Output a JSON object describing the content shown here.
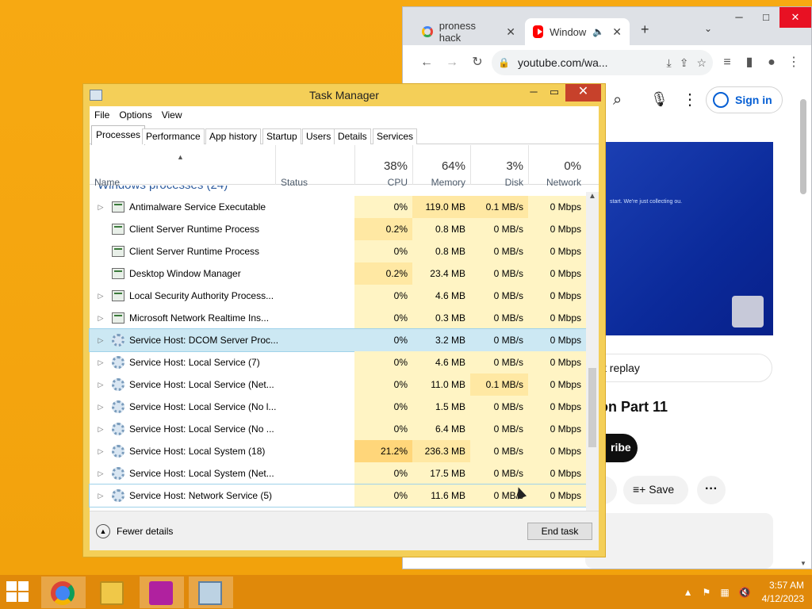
{
  "chrome": {
    "tabs": [
      {
        "title": "proness hack",
        "close": "✕"
      },
      {
        "title": "Window",
        "close": "✕"
      }
    ],
    "new_tab": "+",
    "url": "youtube.com/wa...",
    "youtube": {
      "sign_in": "Sign in",
      "replay": "t replay",
      "title_fragment": "on Part 11",
      "subscribe_fragment": "ribe",
      "save": "Save",
      "video_text": "start. We're just collecting ou."
    }
  },
  "taskmanager": {
    "title": "Task Manager",
    "menu": [
      "File",
      "Options",
      "View"
    ],
    "tabs": [
      "Processes",
      "Performance",
      "App history",
      "Startup",
      "Users",
      "Details",
      "Services"
    ],
    "columns": {
      "name": "Name",
      "status": "Status",
      "cpu": {
        "pct": "38%",
        "label": "CPU"
      },
      "memory": {
        "pct": "64%",
        "label": "Memory"
      },
      "disk": {
        "pct": "3%",
        "label": "Disk"
      },
      "network": {
        "pct": "0%",
        "label": "Network"
      }
    },
    "group_header": "Windows processes (24)",
    "rows": [
      {
        "name": "Antimalware Service Executable",
        "cpu": "0%",
        "memory": "119.0 MB",
        "disk": "0.1 MB/s",
        "network": "0 Mbps"
      },
      {
        "name": "Client Server Runtime Process",
        "cpu": "0.2%",
        "memory": "0.8 MB",
        "disk": "0 MB/s",
        "network": "0 Mbps"
      },
      {
        "name": "Client Server Runtime Process",
        "cpu": "0%",
        "memory": "0.8 MB",
        "disk": "0 MB/s",
        "network": "0 Mbps"
      },
      {
        "name": "Desktop Window Manager",
        "cpu": "0.2%",
        "memory": "23.4 MB",
        "disk": "0 MB/s",
        "network": "0 Mbps"
      },
      {
        "name": "Local Security Authority Process...",
        "cpu": "0%",
        "memory": "4.6 MB",
        "disk": "0 MB/s",
        "network": "0 Mbps"
      },
      {
        "name": "Microsoft Network Realtime Ins...",
        "cpu": "0%",
        "memory": "0.3 MB",
        "disk": "0 MB/s",
        "network": "0 Mbps"
      },
      {
        "name": "Service Host: DCOM Server Proc...",
        "cpu": "0%",
        "memory": "3.2 MB",
        "disk": "0 MB/s",
        "network": "0 Mbps"
      },
      {
        "name": "Service Host: Local Service (7)",
        "cpu": "0%",
        "memory": "4.6 MB",
        "disk": "0 MB/s",
        "network": "0 Mbps"
      },
      {
        "name": "Service Host: Local Service (Net...",
        "cpu": "0%",
        "memory": "11.0 MB",
        "disk": "0.1 MB/s",
        "network": "0 Mbps"
      },
      {
        "name": "Service Host: Local Service (No l...",
        "cpu": "0%",
        "memory": "1.5 MB",
        "disk": "0 MB/s",
        "network": "0 Mbps"
      },
      {
        "name": "Service Host: Local Service (No ...",
        "cpu": "0%",
        "memory": "6.4 MB",
        "disk": "0 MB/s",
        "network": "0 Mbps"
      },
      {
        "name": "Service Host: Local System (18)",
        "cpu": "21.2%",
        "memory": "236.3 MB",
        "disk": "0 MB/s",
        "network": "0 Mbps"
      },
      {
        "name": "Service Host: Local System (Net...",
        "cpu": "0%",
        "memory": "17.5 MB",
        "disk": "0 MB/s",
        "network": "0 Mbps"
      },
      {
        "name": "Service Host: Network Service (5)",
        "cpu": "0%",
        "memory": "11.6 MB",
        "disk": "0 MB/s",
        "network": "0 Mbps"
      }
    ],
    "fewer_details": "Fewer details",
    "end_task": "End task"
  },
  "taskbar": {
    "time": "3:57 AM",
    "date": "4/12/2023"
  }
}
